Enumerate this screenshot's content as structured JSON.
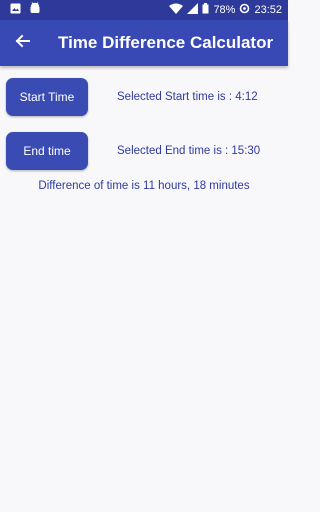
{
  "status_bar": {
    "icons": [
      "image-icon",
      "android-icon",
      "wifi-icon",
      "signal-icon",
      "battery-icon"
    ],
    "battery": "78%",
    "time": "23:52"
  },
  "app_bar": {
    "back_icon": "arrow-left-icon",
    "title": "Time Difference Calculator"
  },
  "main": {
    "start_button_label": "Start Time",
    "start_selected_text": "Selected Start time is : 4:12",
    "end_button_label": "End time",
    "end_selected_text": "Selected End time is : 15:30",
    "difference_text": "Difference of time is 11 hours, 18 minutes"
  },
  "colors": {
    "status_bar": "#2e3a9a",
    "app_bar": "#3848b5",
    "button": "#3a4bb3",
    "label_text": "#2f3aa0",
    "background": "#f8f8fa"
  }
}
